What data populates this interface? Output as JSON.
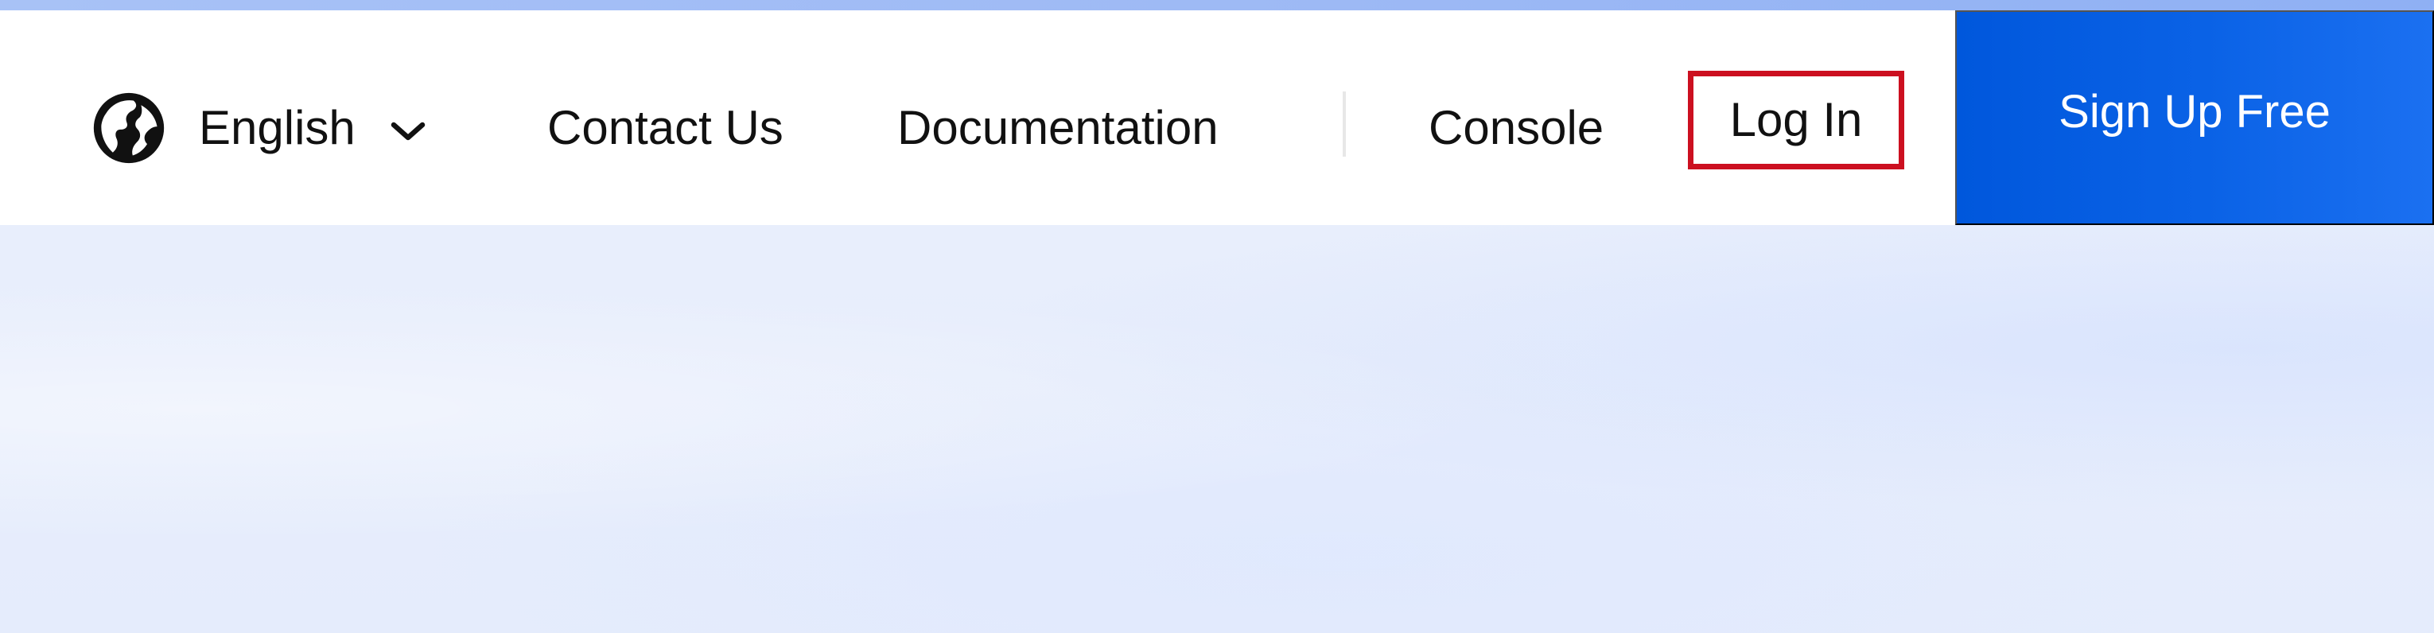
{
  "header": {
    "language": {
      "icon": "globe-icon",
      "label": "English",
      "dropdown_icon": "chevron-down-icon"
    },
    "nav": {
      "contact": "Contact Us",
      "documentation": "Documentation",
      "console": "Console",
      "login": "Log In"
    },
    "signup": {
      "label": "Sign Up Free"
    }
  },
  "colors": {
    "signup_button": "#0a62e6",
    "highlight_border": "#cc1020",
    "top_strip": "#9db9f5",
    "hero_background": "#e8eefc",
    "text": "#111111",
    "header_background": "#ffffff"
  }
}
